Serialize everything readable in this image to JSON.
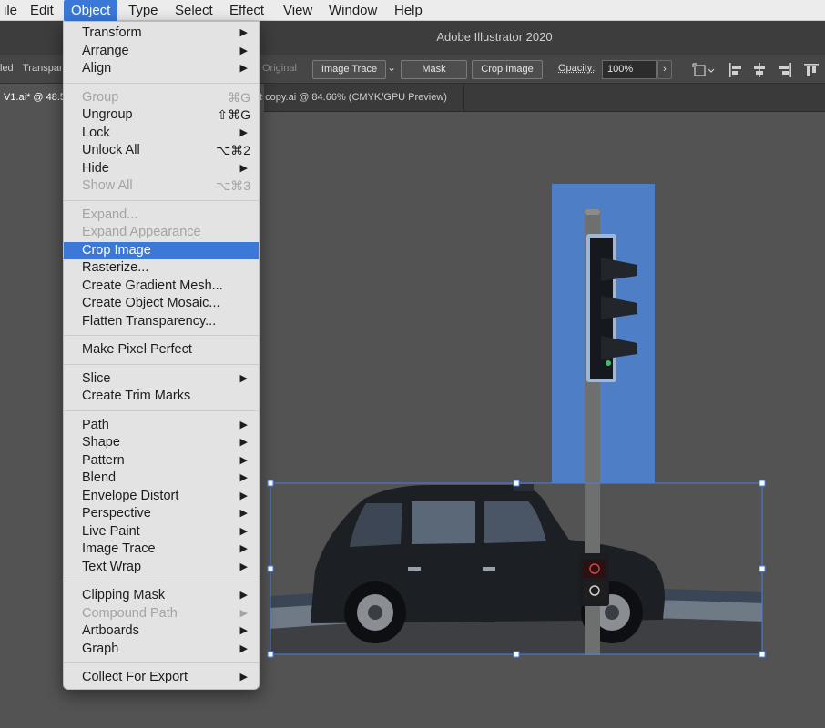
{
  "menubar": {
    "items": [
      "ile",
      "Edit",
      "Object",
      "Type",
      "Select",
      "Effect",
      "View",
      "Window",
      "Help"
    ],
    "active_index": 2
  },
  "app": {
    "title": "Adobe Illustrator 2020"
  },
  "controlbar": {
    "left_text_1": "led",
    "left_text_2": "Transpar",
    "original_label": "Original",
    "image_trace_label": "Image Trace",
    "mask_label": "Mask",
    "crop_image_label": "Crop Image",
    "opacity_label": "Opacity:",
    "opacity_value": "100%",
    "chevron_glyph": "›"
  },
  "tabs": [
    {
      "label": "V1.ai* @ 48.5"
    },
    {
      "label": "t copy.ai @ 84.66% (CMYK/GPU Preview)"
    }
  ],
  "menu": {
    "items": [
      {
        "label": "Transform",
        "submenu": true
      },
      {
        "label": "Arrange",
        "submenu": true
      },
      {
        "label": "Align",
        "submenu": true
      },
      {
        "separator": true
      },
      {
        "label": "Group",
        "shortcut": "⌘G",
        "disabled": true
      },
      {
        "label": "Ungroup",
        "shortcut": "⇧⌘G"
      },
      {
        "label": "Lock",
        "submenu": true
      },
      {
        "label": "Unlock All",
        "shortcut": "⌥⌘2"
      },
      {
        "label": "Hide",
        "submenu": true
      },
      {
        "label": "Show All",
        "shortcut": "⌥⌘3",
        "disabled": true
      },
      {
        "separator": true
      },
      {
        "label": "Expand...",
        "disabled": true
      },
      {
        "label": "Expand Appearance",
        "disabled": true
      },
      {
        "label": "Crop Image",
        "selected": true
      },
      {
        "label": "Rasterize..."
      },
      {
        "label": "Create Gradient Mesh..."
      },
      {
        "label": "Create Object Mosaic..."
      },
      {
        "label": "Flatten Transparency..."
      },
      {
        "separator": true
      },
      {
        "label": "Make Pixel Perfect"
      },
      {
        "separator": true
      },
      {
        "label": "Slice",
        "submenu": true
      },
      {
        "label": "Create Trim Marks"
      },
      {
        "separator": true
      },
      {
        "label": "Path",
        "submenu": true
      },
      {
        "label": "Shape",
        "submenu": true
      },
      {
        "label": "Pattern",
        "submenu": true
      },
      {
        "label": "Blend",
        "submenu": true
      },
      {
        "label": "Envelope Distort",
        "submenu": true
      },
      {
        "label": "Perspective",
        "submenu": true
      },
      {
        "label": "Live Paint",
        "submenu": true
      },
      {
        "label": "Image Trace",
        "submenu": true
      },
      {
        "label": "Text Wrap",
        "submenu": true
      },
      {
        "separator": true
      },
      {
        "label": "Clipping Mask",
        "submenu": true
      },
      {
        "label": "Compound Path",
        "submenu": true,
        "disabled": true
      },
      {
        "label": "Artboards",
        "submenu": true
      },
      {
        "label": "Graph",
        "submenu": true
      },
      {
        "separator": true
      },
      {
        "label": "Collect For Export",
        "submenu": true
      }
    ]
  },
  "colors": {
    "menu_highlight": "#3b78d8",
    "selection_blue": "#4a7fe0",
    "traffic_light_backdrop": "#4e7fc6",
    "canvas_gray": "#535353"
  },
  "icons": {
    "submenu_arrow": "▶"
  }
}
